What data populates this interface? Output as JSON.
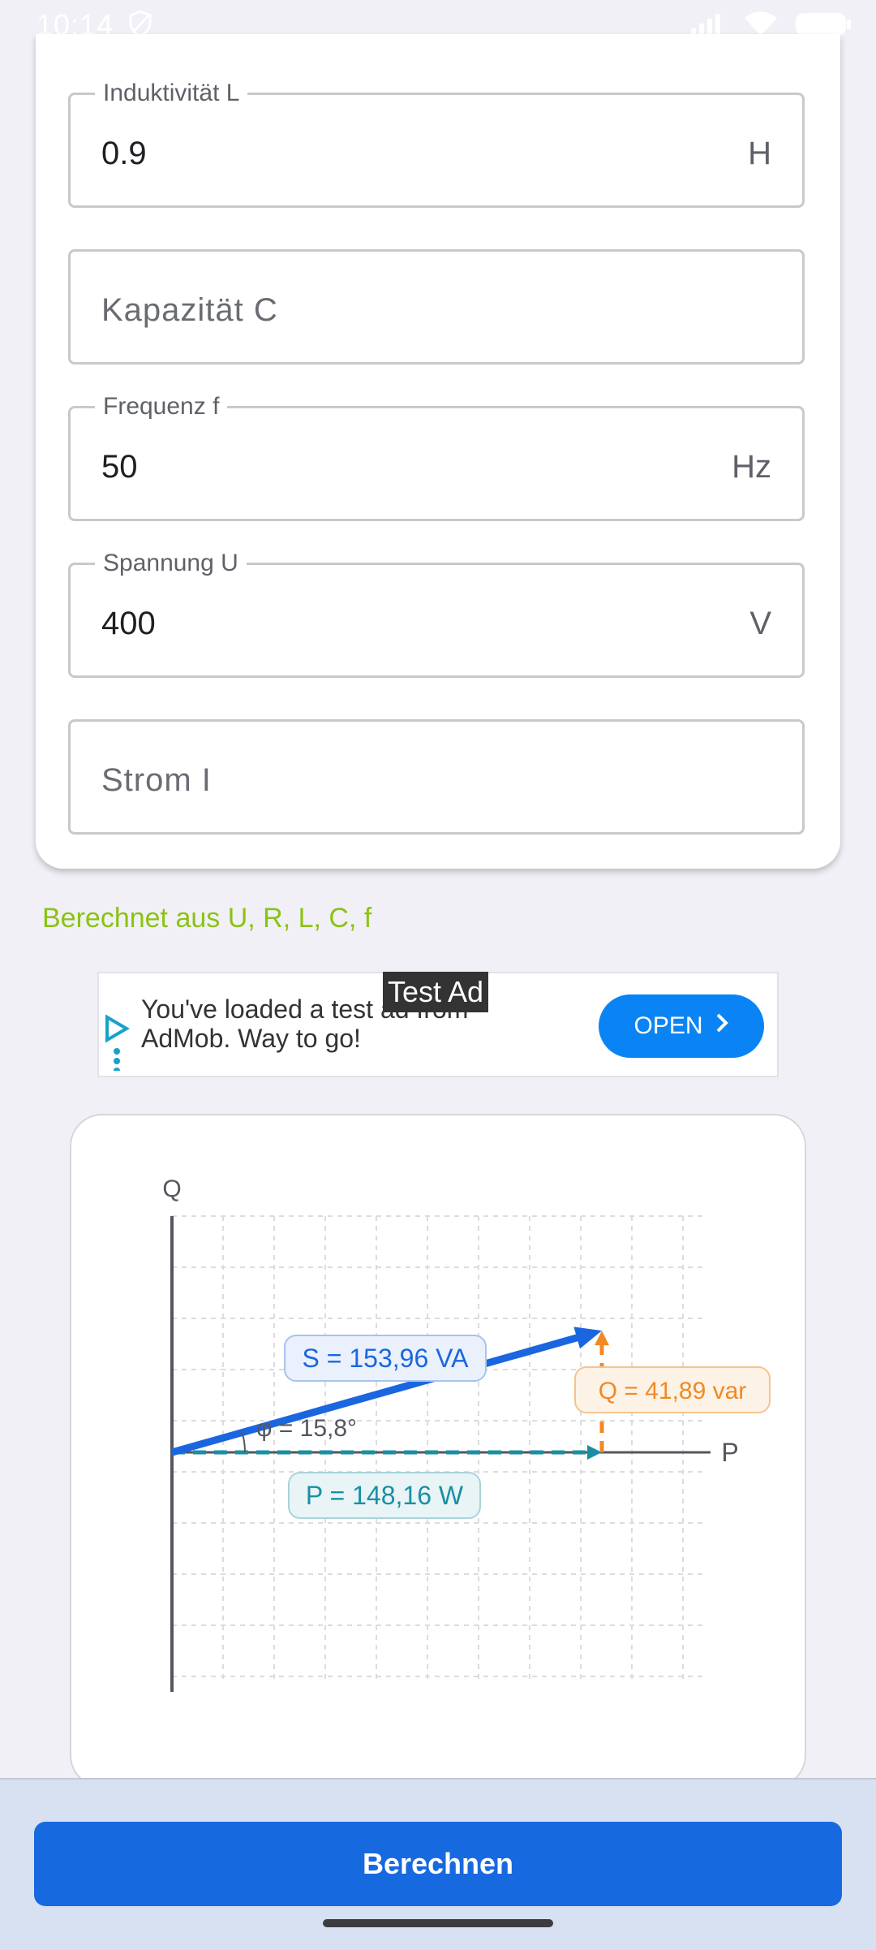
{
  "status_bar": {
    "time": "10:14"
  },
  "fields": [
    {
      "label": "Induktivität L",
      "value": "0.9",
      "unit": "H",
      "placeholder": ""
    },
    {
      "label": "",
      "value": "",
      "unit": "",
      "placeholder": "Kapazität C"
    },
    {
      "label": "Frequenz f",
      "value": "50",
      "unit": "Hz",
      "placeholder": ""
    },
    {
      "label": "Spannung U",
      "value": "400",
      "unit": "V",
      "placeholder": ""
    },
    {
      "label": "",
      "value": "",
      "unit": "",
      "placeholder": "Strom I"
    }
  ],
  "computed_note": "Berechnet aus U, R, L, C, f",
  "ad": {
    "tag": "Test Ad",
    "text": "You've loaded a test ad from AdMob. Way to go!",
    "button": "OPEN"
  },
  "diagram": {
    "axis_q": "Q",
    "axis_p": "P",
    "label_s": "S = 153,96 VA",
    "label_q": "Q = 41,89 var",
    "label_p": "P = 148,16 W",
    "label_phi": "φ = 15,8°",
    "values": {
      "S_VA": 153.96,
      "Q_var": 41.89,
      "P_W": 148.16,
      "phi_deg": 15.8
    },
    "colors": {
      "S": "#1a66e0",
      "P": "#1a8fa4",
      "Q": "#f08a24",
      "axis": "#55565e"
    }
  },
  "bottom": {
    "button": "Berechnen"
  }
}
